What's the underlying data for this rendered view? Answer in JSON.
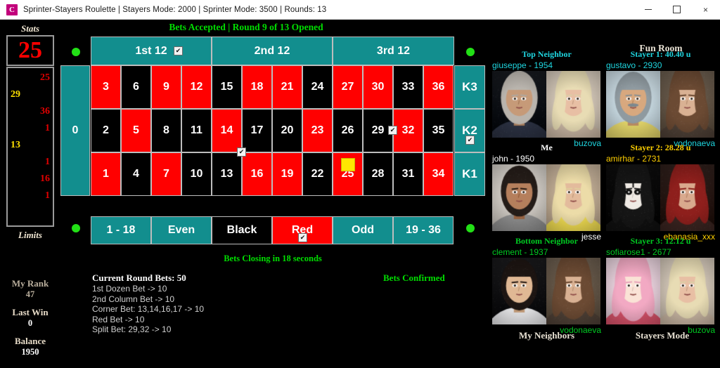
{
  "window": {
    "title": "Sprinter-Stayers Roulette | Stayers Mode: 2000 | Sprinter Mode: 3500 | Rounds: 13",
    "icon_letter": "C",
    "minimize_label": "",
    "maximize_label": "",
    "close_label": "×"
  },
  "header": {
    "status": "Bets Accepted | Round 9 of 13 Opened"
  },
  "stats": {
    "title": "Stats",
    "last_number": "25",
    "history": [
      {
        "value": "25",
        "color": "red"
      },
      {
        "value": "29",
        "color": "yellow"
      },
      {
        "value": "36",
        "color": "red"
      },
      {
        "value": "1",
        "color": "red"
      },
      {
        "value": "13",
        "color": "yellow"
      },
      {
        "value": "1",
        "color": "red"
      },
      {
        "value": "16",
        "color": "red"
      },
      {
        "value": "1",
        "color": "red"
      }
    ]
  },
  "limits": {
    "title": "Limits",
    "my_rank_label": "My Rank",
    "my_rank_value": "47",
    "last_win_label": "Last Win",
    "last_win_value": "0",
    "balance_label": "Balance",
    "balance_value": "1950"
  },
  "table": {
    "zero": "0",
    "dozens": [
      {
        "label": "1st 12",
        "checked": true
      },
      {
        "label": "2nd 12",
        "checked": false
      },
      {
        "label": "3rd 12",
        "checked": false
      }
    ],
    "columns": [
      {
        "label": "K3",
        "checked": false
      },
      {
        "label": "K2",
        "checked": true
      },
      {
        "label": "K1",
        "checked": false
      }
    ],
    "rows": [
      [
        {
          "n": "3",
          "c": "red"
        },
        {
          "n": "6",
          "c": "black"
        },
        {
          "n": "9",
          "c": "red"
        },
        {
          "n": "12",
          "c": "red"
        },
        {
          "n": "15",
          "c": "black"
        },
        {
          "n": "18",
          "c": "red"
        },
        {
          "n": "21",
          "c": "red"
        },
        {
          "n": "24",
          "c": "black"
        },
        {
          "n": "27",
          "c": "red"
        },
        {
          "n": "30",
          "c": "red"
        },
        {
          "n": "33",
          "c": "black"
        },
        {
          "n": "36",
          "c": "red"
        }
      ],
      [
        {
          "n": "2",
          "c": "black"
        },
        {
          "n": "5",
          "c": "red"
        },
        {
          "n": "8",
          "c": "black"
        },
        {
          "n": "11",
          "c": "black"
        },
        {
          "n": "14",
          "c": "red"
        },
        {
          "n": "17",
          "c": "black"
        },
        {
          "n": "20",
          "c": "black"
        },
        {
          "n": "23",
          "c": "red"
        },
        {
          "n": "26",
          "c": "black"
        },
        {
          "n": "29",
          "c": "black"
        },
        {
          "n": "32",
          "c": "red"
        },
        {
          "n": "35",
          "c": "black"
        }
      ],
      [
        {
          "n": "1",
          "c": "red"
        },
        {
          "n": "4",
          "c": "black"
        },
        {
          "n": "7",
          "c": "red"
        },
        {
          "n": "10",
          "c": "black"
        },
        {
          "n": "13",
          "c": "black"
        },
        {
          "n": "16",
          "c": "red"
        },
        {
          "n": "19",
          "c": "red"
        },
        {
          "n": "22",
          "c": "black"
        },
        {
          "n": "25",
          "c": "red"
        },
        {
          "n": "28",
          "c": "black"
        },
        {
          "n": "31",
          "c": "black"
        },
        {
          "n": "34",
          "c": "red"
        }
      ]
    ],
    "outside": [
      {
        "label": "1 - 18",
        "style": "teal",
        "checked": false
      },
      {
        "label": "Even",
        "style": "teal",
        "checked": false
      },
      {
        "label": "Black",
        "style": "black",
        "checked": false
      },
      {
        "label": "Red",
        "style": "red",
        "checked": true
      },
      {
        "label": "Odd",
        "style": "teal",
        "checked": false
      },
      {
        "label": "19 - 36",
        "style": "teal",
        "checked": false
      }
    ],
    "winning_marker_number": "25",
    "closing_text": "Bets Closing in 18 seconds"
  },
  "bets": {
    "title": "Current Round Bets: 50",
    "confirmed": "Bets Confirmed",
    "lines": [
      "1st Dozen Bet -> 10",
      "2nd Column Bet -> 10",
      "Corner Bet: 13,14,16,17 -> 10",
      "Red Bet -> 10",
      "Split Bet: 29,32 -> 10"
    ]
  },
  "right": {
    "fun_room_title": "Fun Room",
    "my_neighbors_label": "My Neighbors",
    "stayers_mode_label": "Stayers Mode",
    "groups": [
      {
        "head": "Top Neighbor",
        "head_color": "cyan",
        "sub": "giuseppe -  1954",
        "sub_color": "cyan",
        "foot": "buzova",
        "foot_color": "cyan",
        "left_photo": "man-grey-hair-suit",
        "right_photo": "woman-blonde-smiling"
      },
      {
        "head": "Stayer 1: 40.40 u",
        "head_color": "cyan",
        "sub": "gustavo -  2930",
        "sub_color": "cyan",
        "foot": "vodonaeva",
        "foot_color": "cyan",
        "left_photo": "older-man-moustache-painting",
        "right_photo": "woman-brown-hair-hand-chin"
      },
      {
        "head": "Me",
        "head_color": "white",
        "sub": "john - 1950",
        "sub_color": "white",
        "foot": "jesse",
        "foot_color": "white",
        "left_photo": "man-red-carpet-grey-jacket",
        "right_photo": "woman-blonde-yellow-top"
      },
      {
        "head": "Stayer 2: 28.28 u",
        "head_color": "yellow",
        "sub": "amirhar -  2731",
        "sub_color": "yellow",
        "foot": "ebanasia_xxx",
        "foot_color": "yellow",
        "left_photo": "gothic-painted-face-person",
        "right_photo": "woman-red-hair-tattoo"
      },
      {
        "head": "Bottom Neighbor",
        "head_color": "green",
        "sub": "clement -  1937",
        "sub_color": "green",
        "foot": "vodonaeva",
        "foot_color": "green",
        "left_photo": "young-man-suit-tie",
        "right_photo": "woman-brown-hair-hand-chin"
      },
      {
        "head": "Stayer 3: 12.12 u",
        "head_color": "green",
        "sub": "sofiarose1 -  2677",
        "sub_color": "green",
        "foot": "buzova",
        "foot_color": "green",
        "left_photo": "anime-pink-hair-girl",
        "right_photo": "woman-blonde-smiling"
      }
    ]
  },
  "colors": {
    "teal": "#128e8e",
    "red": "#ff0000",
    "black": "#000000",
    "green_status": "#00dd00",
    "dot_green": "#22e016",
    "marker_yellow": "#ffe800"
  }
}
